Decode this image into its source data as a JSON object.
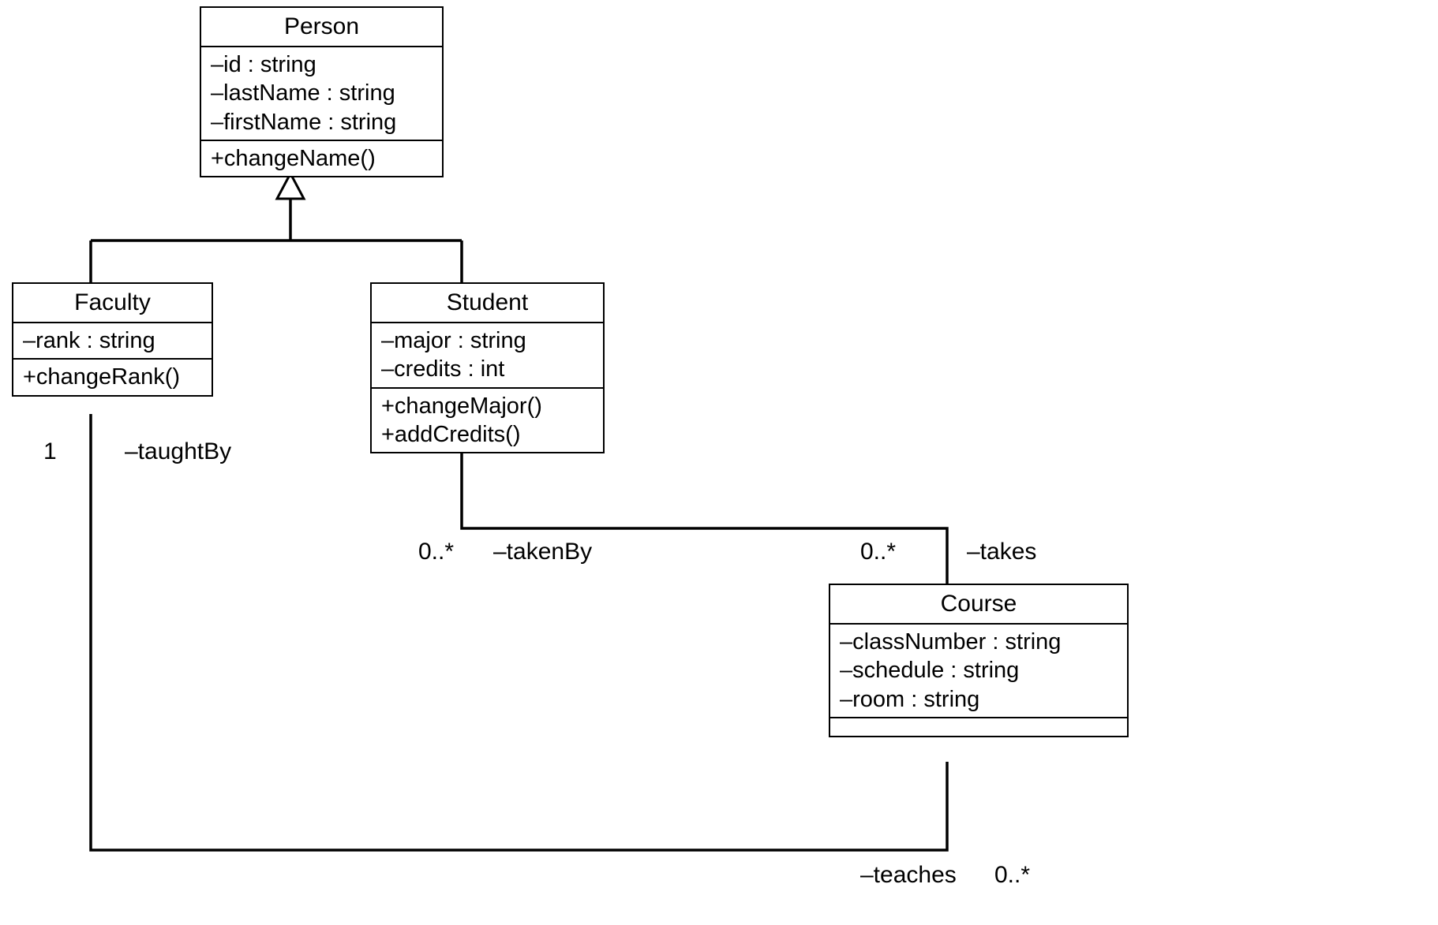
{
  "diagram_type": "UML Class Diagram",
  "classes": {
    "person": {
      "name": "Person",
      "attributes": [
        "–id : string",
        "–lastName : string",
        "–firstName : string"
      ],
      "operations": [
        "+changeName()"
      ]
    },
    "faculty": {
      "name": "Faculty",
      "attributes": [
        "–rank : string"
      ],
      "operations": [
        "+changeRank()"
      ]
    },
    "student": {
      "name": "Student",
      "attributes": [
        "–major : string",
        "–credits : int"
      ],
      "operations": [
        "+changeMajor()",
        "+addCredits()"
      ]
    },
    "course": {
      "name": "Course",
      "attributes": [
        "–classNumber : string",
        "–schedule : string",
        "–room : string"
      ],
      "operations": []
    }
  },
  "labels": {
    "taughtBy_m": "1",
    "taughtBy": "–taughtBy",
    "takenBy_m": "0..*",
    "takenBy": "–takenBy",
    "takes_m": "0..*",
    "takes": "–takes",
    "teaches_m": "0..*",
    "teaches": "–teaches"
  }
}
